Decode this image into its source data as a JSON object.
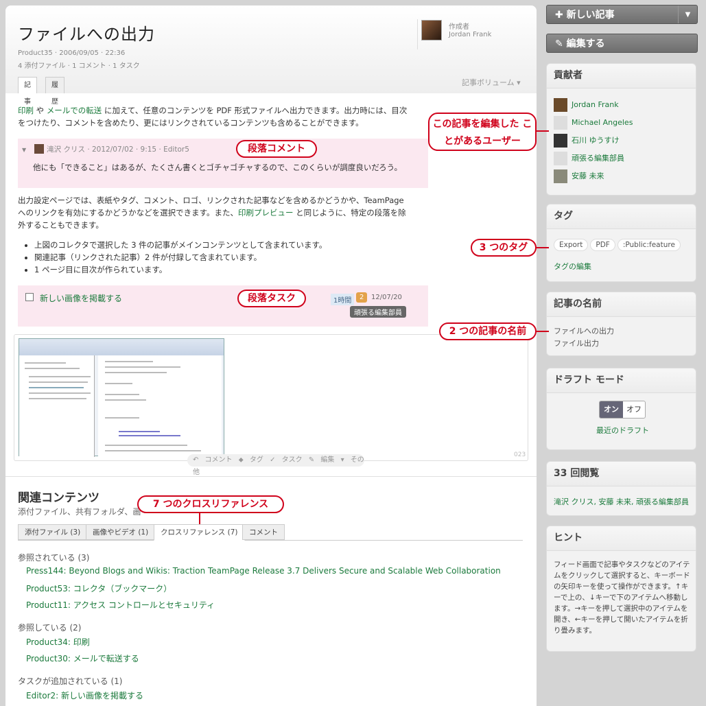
{
  "article": {
    "title": "ファイルへの出力",
    "meta1": "Product35 · 2006/09/05 · 22:36",
    "meta2": "4 添付ファイル · 1 コメント · 1 タスク",
    "author_label": "作成者",
    "author_name": "Jordan Frank",
    "tabs": [
      "記事",
      "履歴"
    ],
    "volume": "記事ボリューム ▾",
    "p1_link1": "印刷",
    "p1_mid": " や ",
    "p1_link2": "メールでの転送",
    "p1_rest1": " に加えて、任意のコンテンツを PDF 形式ファイルへ出力できます。出力時には、目次",
    "p1_rest2": "をつけたり、コメントを含めたり、更にはリンクされているコンテンツも含めることができます。",
    "comment_header": "滝沢 クリス · 2012/07/02 · 9:15 · Editor5",
    "comment_body": "他にも「できること」はあるが、たくさん書くとゴチャゴチャするので、このくらいが調度良いだろう。",
    "p2_line1": "出力設定ページでは、表紙やタグ、コメント、ロゴ、リンクされた記事などを含めるかどうかや、TeamPage",
    "p2_line2": "へのリンクを有効にするかどうかなどを選択できます。また、",
    "p2_link": "印刷プレビュー",
    "p2_line2b": " と同じように、特定の段落を除",
    "p2_line3": "外することもできます。",
    "bullets": [
      "上図のコレクタで選択した 3 件の記事がメインコンテンツとして含まれています。",
      "関連記事（リンクされた記事）2 件が付録して含まれています。",
      "1 ページ目に目次が作られています。"
    ],
    "task_text": "新しい画像を掲載する",
    "task_hours": "1時間",
    "task_num": "2",
    "task_date": "12/07/20",
    "task_assignee": "頑張る編集部員",
    "image_number": "023",
    "actions": "↶ コメント  ⬥ タグ  ✓ タスク  ✎ 編集  ▾ その他"
  },
  "related": {
    "heading": "関連コンテンツ",
    "subtitle": "添付ファイル、共有フォルダ、画",
    "tabs": [
      "添付ファイル (3)",
      "画像やビデオ (1)",
      "クロスリファレンス (7)",
      "コメント"
    ],
    "group1": "参照されている (3)",
    "group1_items": [
      "Press144: Beyond Blogs and Wikis: Traction TeamPage Release 3.7 Delivers Secure and Scalable Web Collaboration",
      "Product53: コレクタ（ブックマーク）",
      "Product11: アクセス コントロールとセキュリティ"
    ],
    "group2": "参照している (2)",
    "group2_items": [
      "Product34: 印刷",
      "Product30: メールで転送する"
    ],
    "group3": "タスクが追加されている (1)",
    "group3_items": [
      "Editor2: 新しい画像を掲載する"
    ]
  },
  "sidebar": {
    "new_article": "✚ 新しい記事",
    "edit": "✎ 編集する",
    "contributors_title": "貢献者",
    "contributors": [
      "Jordan Frank",
      "Michael Angeles",
      "石川 ゆうすけ",
      "頑張る編集部員",
      "安藤 未来"
    ],
    "tags_title": "タグ",
    "tags": [
      "Export",
      "PDF",
      ":Public:feature"
    ],
    "tags_edit": "タグの編集",
    "names_title": "記事の名前",
    "names": [
      "ファイルへの出力",
      "ファイル出力"
    ],
    "draft_title": "ドラフト モード",
    "draft_on": "オン",
    "draft_off": "オフ",
    "draft_recent": "最近のドラフト",
    "views_title": "33 回閲覧",
    "views_users": "滝沢 クリス, 安藤 未来, 頑張る編集部員",
    "hint_title": "ヒント",
    "hint_text": "フィード画面で記事やタスクなどのアイテムをクリックして選択すると、キーボードの矢印キーを使って操作ができます。↑キーで上の、↓キーで下のアイテムへ移動します。→キーを押して選択中のアイテムを開き、←キーを押して開いたアイテムを折り畳みます。"
  },
  "callouts": {
    "users": "この記事を編集した ことがあるユーザー",
    "tags": "3 つのタグ",
    "names": "2 つの記事の名前",
    "para_comment": "段落コメント",
    "para_task": "段落タスク",
    "xref": "7 つのクロスリファレンス"
  }
}
